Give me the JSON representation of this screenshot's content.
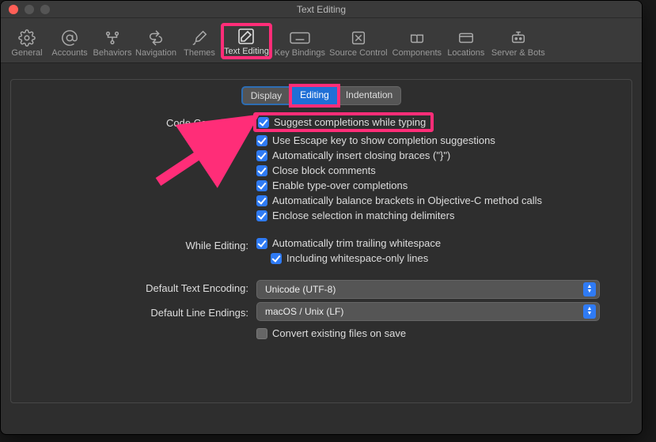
{
  "window": {
    "title": "Text Editing"
  },
  "toolbar": {
    "items": [
      {
        "label": "General"
      },
      {
        "label": "Accounts"
      },
      {
        "label": "Behaviors"
      },
      {
        "label": "Navigation"
      },
      {
        "label": "Themes"
      },
      {
        "label": "Text Editing"
      },
      {
        "label": "Key Bindings"
      },
      {
        "label": "Source Control"
      },
      {
        "label": "Components"
      },
      {
        "label": "Locations"
      },
      {
        "label": "Server & Bots"
      }
    ]
  },
  "tabs": {
    "display": "Display",
    "editing": "Editing",
    "indentation": "Indentation"
  },
  "sections": {
    "code_completion": {
      "label": "Code Completion:",
      "opts": [
        "Suggest completions while typing",
        "Use Escape key to show completion suggestions",
        "Automatically insert closing braces (\"}\")",
        "Close block comments",
        "Enable type-over completions",
        "Automatically balance brackets in Objective-C method calls",
        "Enclose selection in matching delimiters"
      ]
    },
    "while_editing": {
      "label": "While Editing:",
      "opts": [
        "Automatically trim trailing whitespace",
        "Including whitespace-only lines"
      ]
    },
    "encoding": {
      "label": "Default Text Encoding:",
      "value": "Unicode (UTF-8)"
    },
    "endings": {
      "label": "Default Line Endings:",
      "value": "macOS / Unix (LF)",
      "convert": "Convert existing files on save"
    }
  }
}
